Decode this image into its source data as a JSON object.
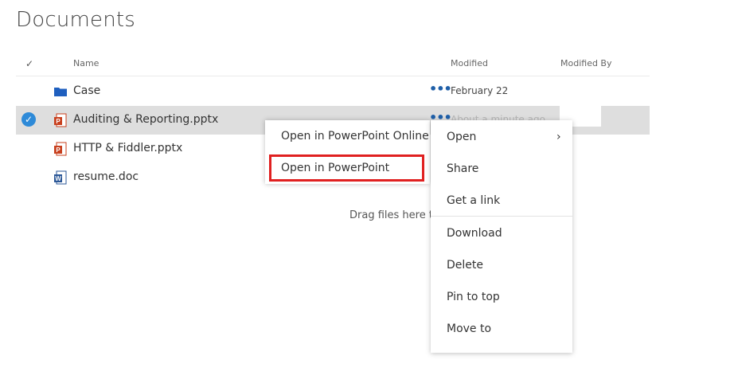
{
  "page_title": "Documents",
  "columns": {
    "select_all": "✓",
    "name": "Name",
    "modified": "Modified",
    "modified_by": "Modified By"
  },
  "rows": [
    {
      "name": "Case",
      "type": "folder",
      "modified": "February 22",
      "ellipsis": "•••"
    },
    {
      "name": "Auditing & Reporting.pptx",
      "type": "pptx",
      "modified": "About a minute ago",
      "ellipsis": "•••",
      "selected": true
    },
    {
      "name": "HTTP & Fiddler.pptx",
      "type": "pptx"
    },
    {
      "name": "resume.doc",
      "type": "doc"
    }
  ],
  "drop_hint": "Drag files here to",
  "submenu": {
    "items": [
      "Open in PowerPoint Online",
      "Open in PowerPoint"
    ],
    "highlighted_index": 1
  },
  "context_menu": {
    "items": [
      "Open",
      "Share",
      "Get a link",
      "Download",
      "Delete",
      "Pin to top",
      "Move to"
    ],
    "open_chevron": "›"
  },
  "colors": {
    "selected_row": "#dedede",
    "check_blue": "#2e8ad8",
    "highlight_red": "#e02020",
    "ellipsis_blue": "#1f5fa8",
    "folder_blue": "#1f5fbf",
    "ppt_red": "#c8401e",
    "word_blue": "#2b5797"
  },
  "icons": {
    "folder": "folder-icon",
    "pptx": "powerpoint-file-icon",
    "doc": "word-file-icon",
    "check": "checkmark-icon",
    "chevron": "chevron-right-icon"
  }
}
